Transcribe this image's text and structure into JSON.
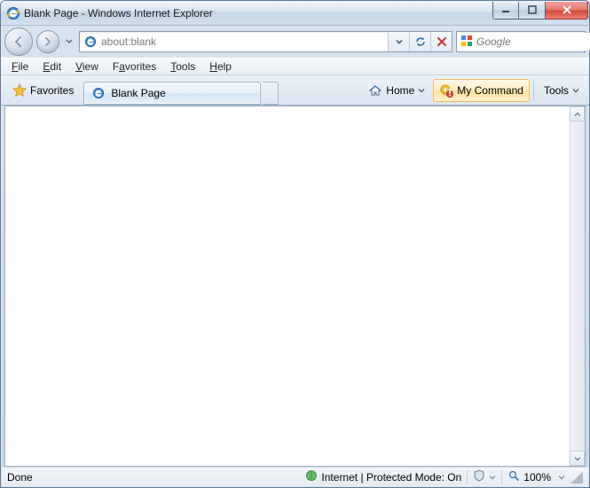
{
  "titlebar": {
    "title": "Blank Page - Windows Internet Explorer"
  },
  "nav": {
    "address": "about:blank",
    "search_placeholder": "Google"
  },
  "menu": {
    "file": "File",
    "edit": "Edit",
    "view": "View",
    "favorites": "Favorites",
    "tools": "Tools",
    "help": "Help"
  },
  "cmdbar": {
    "favorites_label": "Favorites",
    "tab_title": "Blank Page",
    "home_label": "Home",
    "mycommand_label": "My Command",
    "tools_label": "Tools"
  },
  "status": {
    "left": "Done",
    "zone": "Internet | Protected Mode: On",
    "zoom": "100%"
  },
  "icons": {
    "app": "ie-icon",
    "back": "arrow-left-icon",
    "forward": "arrow-right-icon",
    "refresh": "refresh-icon",
    "stop": "stop-icon",
    "search": "magnifier-icon",
    "google": "google-icon",
    "star": "star-icon",
    "page": "ie-page-icon",
    "home": "home-icon",
    "mycommand": "gear-alert-icon",
    "globe": "globe-icon",
    "shield": "shield-icon",
    "zoom": "magnifier-icon"
  }
}
